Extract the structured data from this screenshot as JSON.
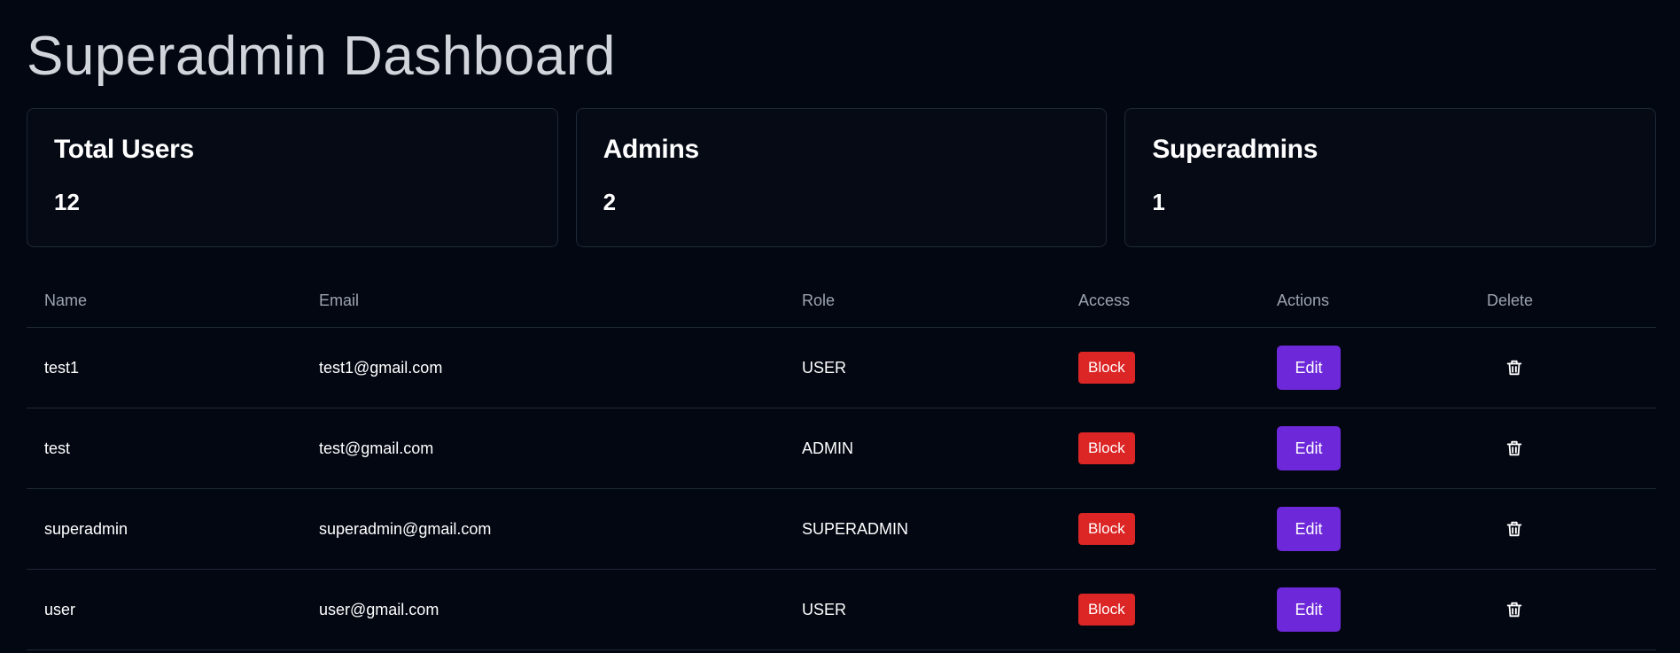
{
  "page": {
    "title": "Superadmin Dashboard"
  },
  "stats": [
    {
      "title": "Total Users",
      "value": "12"
    },
    {
      "title": "Admins",
      "value": "2"
    },
    {
      "title": "Superadmins",
      "value": "1"
    }
  ],
  "table": {
    "headers": {
      "name": "Name",
      "email": "Email",
      "role": "Role",
      "access": "Access",
      "actions": "Actions",
      "delete": "Delete"
    },
    "rows": [
      {
        "name": "test1",
        "email": "test1@gmail.com",
        "role": "USER",
        "access": "Block",
        "action": "Edit",
        "delete_icon": "trash-icon"
      },
      {
        "name": "test",
        "email": "test@gmail.com",
        "role": "ADMIN",
        "access": "Block",
        "action": "Edit",
        "delete_icon": "trash-icon"
      },
      {
        "name": "superadmin",
        "email": "superadmin@gmail.com",
        "role": "SUPERADMIN",
        "access": "Block",
        "action": "Edit",
        "delete_icon": "trash-icon"
      },
      {
        "name": "user",
        "email": "user@gmail.com",
        "role": "USER",
        "access": "Block",
        "action": "Edit",
        "delete_icon": "trash-icon"
      }
    ]
  },
  "colors": {
    "background": "#030712",
    "block": "#dc2626",
    "edit": "#6d28d9",
    "border": "#1f2937"
  }
}
